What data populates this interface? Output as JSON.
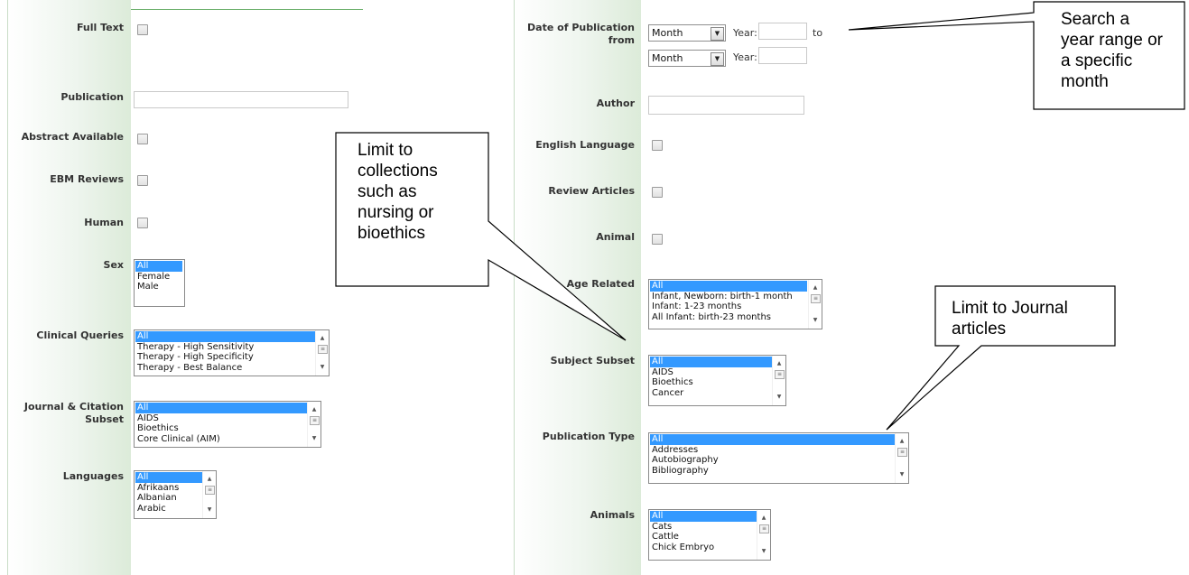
{
  "left": {
    "full_text": {
      "label": "Full Text"
    },
    "publication": {
      "label": "Publication",
      "value": ""
    },
    "abstract_available": {
      "label": "Abstract Available"
    },
    "ebm_reviews": {
      "label": "EBM Reviews"
    },
    "human": {
      "label": "Human"
    },
    "sex": {
      "label": "Sex",
      "options": [
        "All",
        "Female",
        "Male"
      ],
      "selected": "All"
    },
    "clinical_queries": {
      "label": "Clinical Queries",
      "options": [
        "All",
        "Therapy - High Sensitivity",
        "Therapy - High Specificity",
        "Therapy - Best Balance"
      ],
      "selected": "All"
    },
    "journal_citation_subset": {
      "label_line1": "Journal & Citation",
      "label_line2": "Subset",
      "options": [
        "All",
        "AIDS",
        "Bioethics",
        "Core Clinical (AIM)"
      ],
      "selected": "All"
    },
    "languages": {
      "label": "Languages",
      "options": [
        "All",
        "Afrikaans",
        "Albanian",
        "Arabic"
      ],
      "selected": "All"
    }
  },
  "right": {
    "date_of_publication": {
      "label_line1": "Date of Publication",
      "label_line2": "from",
      "month_from": "Month",
      "month_to": "Month",
      "year_label": "Year:",
      "to_label": "to",
      "year_from": "",
      "year_to": ""
    },
    "author": {
      "label": "Author",
      "value": ""
    },
    "english_language": {
      "label": "English Language"
    },
    "review_articles": {
      "label": "Review Articles"
    },
    "animal": {
      "label": "Animal"
    },
    "age_related": {
      "label": "Age Related",
      "options": [
        "All",
        "Infant, Newborn: birth-1 month",
        "Infant: 1-23 months",
        "All Infant: birth-23 months"
      ],
      "selected": "All"
    },
    "subject_subset": {
      "label": "Subject Subset",
      "options": [
        "All",
        "AIDS",
        "Bioethics",
        "Cancer"
      ],
      "selected": "All"
    },
    "publication_type": {
      "label": "Publication Type",
      "options": [
        "All",
        "Addresses",
        "Autobiography",
        "Bibliography"
      ],
      "selected": "All"
    },
    "animals": {
      "label": "Animals",
      "options": [
        "All",
        "Cats",
        "Cattle",
        "Chick Embryo"
      ],
      "selected": "All"
    }
  },
  "callouts": {
    "collections": [
      "Limit to",
      "collections",
      "such as",
      "nursing or",
      "bioethics"
    ],
    "year_range": [
      "Search a",
      "year range or",
      "a specific",
      "month"
    ],
    "journal": [
      "Limit to Journal",
      "articles"
    ]
  },
  "colors": {
    "accent_green": "#6cb06c",
    "selection_blue": "#3399ff",
    "label_text": "#333333"
  },
  "icons": {
    "scroll_up": "▲",
    "scroll_down": "▼",
    "scroll_grip": "≡",
    "dropdown": "▼"
  }
}
